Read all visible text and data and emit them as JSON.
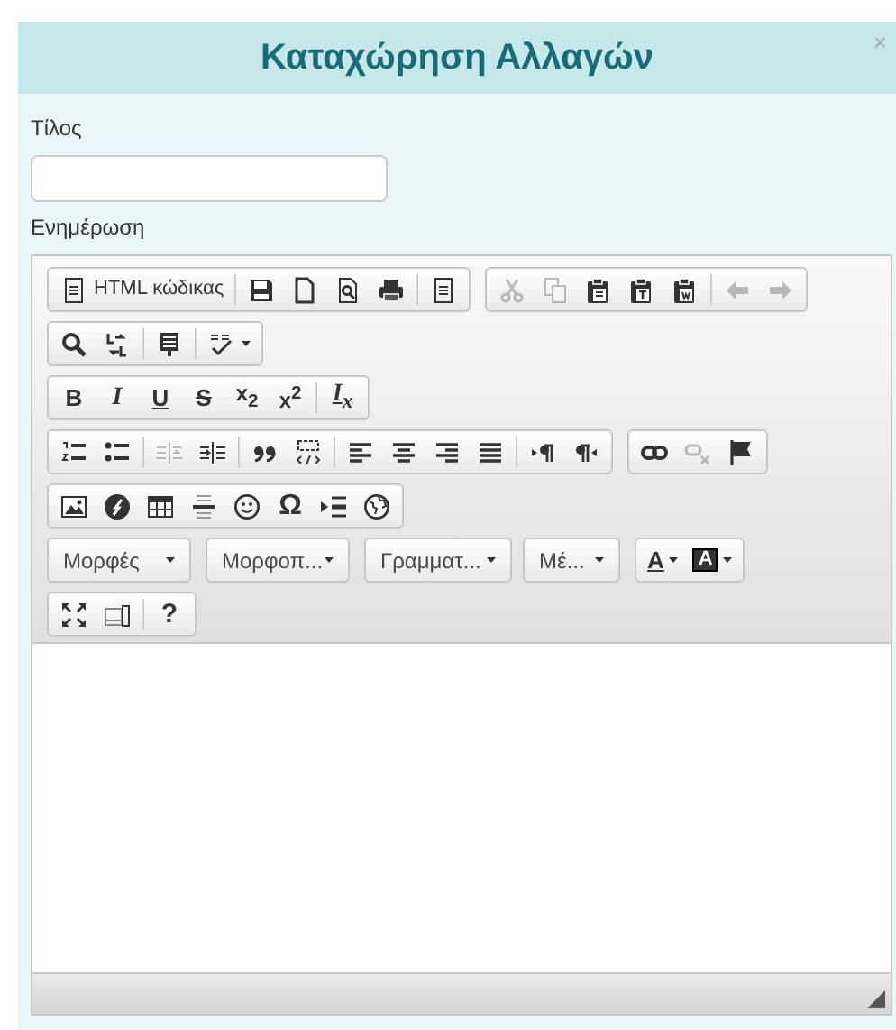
{
  "dialog": {
    "title": "Καταχώρηση Αλλαγών",
    "close": "×"
  },
  "title_field": {
    "label": "Τίλος"
  },
  "update_field": {
    "label": "Ενημέρωση"
  },
  "toolbar": {
    "rows": [
      {
        "groups": [
          {
            "items": [
              {
                "kind": "source",
                "label": "HTML κώδικας",
                "disabled": false
              },
              {
                "kind": "sep"
              },
              {
                "kind": "save",
                "disabled": false
              },
              {
                "kind": "newpage",
                "disabled": false
              },
              {
                "kind": "preview",
                "disabled": false
              },
              {
                "kind": "print",
                "disabled": false
              },
              {
                "kind": "sep"
              },
              {
                "kind": "templates",
                "disabled": false
              }
            ]
          },
          {
            "items": [
              {
                "kind": "cut",
                "disabled": true
              },
              {
                "kind": "copy",
                "disabled": true
              },
              {
                "kind": "paste",
                "disabled": false
              },
              {
                "kind": "pastetext",
                "disabled": false
              },
              {
                "kind": "pasteword",
                "disabled": false
              },
              {
                "kind": "sep"
              },
              {
                "kind": "undo",
                "disabled": true
              },
              {
                "kind": "redo",
                "disabled": true
              }
            ]
          }
        ]
      },
      {
        "groups": [
          {
            "items": [
              {
                "kind": "find",
                "disabled": false
              },
              {
                "kind": "replace",
                "disabled": false
              },
              {
                "kind": "sep"
              },
              {
                "kind": "selectall",
                "disabled": false
              },
              {
                "kind": "sep"
              },
              {
                "kind": "spellcheck",
                "disabled": false
              }
            ]
          }
        ]
      },
      {
        "groups": [
          {
            "items": [
              {
                "kind": "bold",
                "label": "B",
                "disabled": false
              },
              {
                "kind": "italic",
                "label": "I",
                "disabled": false
              },
              {
                "kind": "underline",
                "label": "U",
                "disabled": false
              },
              {
                "kind": "strike",
                "label": "S",
                "disabled": false
              },
              {
                "kind": "subscript",
                "label": "x$_{2}$",
                "disabled": false
              },
              {
                "kind": "superscript",
                "label": "x$^{2}$",
                "disabled": false
              },
              {
                "kind": "sep"
              },
              {
                "kind": "removeformat",
                "label": "I$_{x}$",
                "disabled": false
              }
            ]
          }
        ]
      },
      {
        "groups": [
          {
            "items": [
              {
                "kind": "numlist",
                "disabled": false
              },
              {
                "kind": "bulletlist",
                "disabled": false
              },
              {
                "kind": "sep"
              },
              {
                "kind": "outdent",
                "disabled": true
              },
              {
                "kind": "indent",
                "disabled": false
              },
              {
                "kind": "sep"
              },
              {
                "kind": "blockquote",
                "disabled": false
              },
              {
                "kind": "creatediv",
                "disabled": false
              },
              {
                "kind": "sep"
              },
              {
                "kind": "alignleft",
                "disabled": false
              },
              {
                "kind": "aligncenter",
                "disabled": false
              },
              {
                "kind": "alignright",
                "disabled": false
              },
              {
                "kind": "justify",
                "disabled": false
              },
              {
                "kind": "sep"
              },
              {
                "kind": "ltr",
                "disabled": false
              },
              {
                "kind": "rtl",
                "disabled": false
              }
            ]
          },
          {
            "items": [
              {
                "kind": "link",
                "disabled": false
              },
              {
                "kind": "unlink",
                "disabled": true
              },
              {
                "kind": "anchor",
                "disabled": false
              }
            ]
          }
        ]
      },
      {
        "groups": [
          {
            "items": [
              {
                "kind": "image",
                "disabled": false
              },
              {
                "kind": "flash",
                "disabled": false
              },
              {
                "kind": "table",
                "disabled": false
              },
              {
                "kind": "hr",
                "disabled": false
              },
              {
                "kind": "smiley",
                "disabled": false
              },
              {
                "kind": "specialchar",
                "label": "Ω",
                "disabled": false
              },
              {
                "kind": "pagebreak",
                "disabled": false
              },
              {
                "kind": "iframe",
                "disabled": false
              }
            ]
          }
        ]
      },
      {
        "groups": [
          {
            "items": [
              {
                "kind": "combo",
                "label": "Μορφές"
              }
            ]
          },
          {
            "items": [
              {
                "kind": "combo",
                "label": "Μορφοπ..."
              }
            ]
          },
          {
            "items": [
              {
                "kind": "combo",
                "label": "Γραμματ..."
              }
            ]
          },
          {
            "items": [
              {
                "kind": "combo",
                "label": "Μέ..."
              }
            ]
          },
          {
            "items": [
              {
                "kind": "textcolor",
                "label": "A",
                "disabled": false
              },
              {
                "kind": "bgcolor",
                "label": "A",
                "disabled": false
              }
            ]
          }
        ]
      },
      {
        "groups": [
          {
            "items": [
              {
                "kind": "maximize",
                "disabled": false
              },
              {
                "kind": "showblocks",
                "disabled": false
              },
              {
                "kind": "sep"
              },
              {
                "kind": "about",
                "label": "?",
                "disabled": false
              }
            ]
          }
        ]
      }
    ]
  }
}
